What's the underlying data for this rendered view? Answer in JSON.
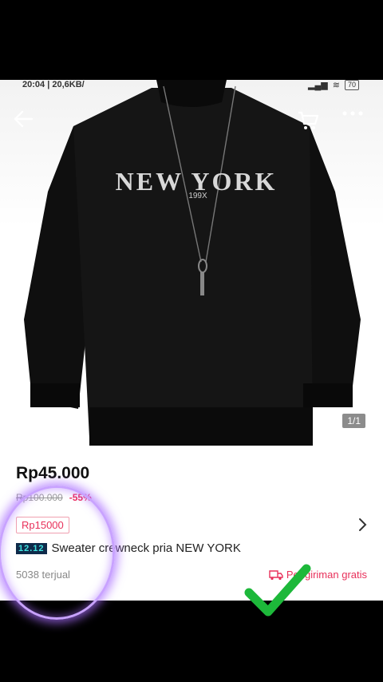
{
  "status_bar": {
    "time": "20:04",
    "speed": "20,6KB/",
    "battery": "70"
  },
  "product": {
    "image_counter": "1/1",
    "shirt_text": "NEW YORK",
    "shirt_subtext": "199X",
    "price": "Rp45.000",
    "original_price": "Rp100.000",
    "discount": "-55%",
    "coupon": "Rp15000",
    "promo_tag": "12.12",
    "title": "Sweater crewneck pria NEW YORK",
    "sold": "5038 terjual",
    "shipping": "Pengiriman gratis"
  },
  "icons": {
    "back": "back-arrow-icon",
    "cart": "cart-icon",
    "more": "more-icon",
    "chevron": "chevron-right-icon",
    "shipping": "truck-icon",
    "check": "check-icon"
  },
  "colors": {
    "accent": "#e8305a",
    "promo_bg": "#0f2a4a",
    "promo_fg": "#3fe3e0",
    "check": "#1db83a",
    "highlight": "#c8a2ff"
  }
}
